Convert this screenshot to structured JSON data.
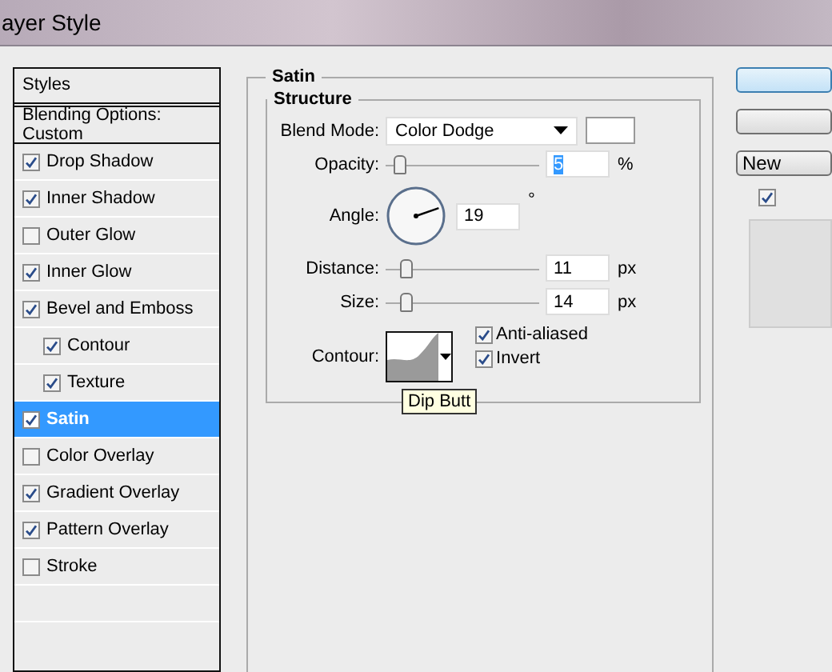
{
  "window": {
    "title": "ayer Style"
  },
  "sidebar": {
    "header": "Styles",
    "items": [
      {
        "kind": "option",
        "label": "Blending Options: Custom",
        "selected": false
      },
      {
        "kind": "effect",
        "label": "Drop Shadow",
        "checked": true,
        "selected": false
      },
      {
        "kind": "effect",
        "label": "Inner Shadow",
        "checked": true,
        "selected": false
      },
      {
        "kind": "effect",
        "label": "Outer Glow",
        "checked": false,
        "selected": false
      },
      {
        "kind": "effect",
        "label": "Inner Glow",
        "checked": true,
        "selected": false
      },
      {
        "kind": "effect",
        "label": "Bevel and Emboss",
        "checked": true,
        "selected": false,
        "children": [
          {
            "kind": "effect",
            "label": "Contour",
            "checked": true,
            "selected": false
          },
          {
            "kind": "effect",
            "label": "Texture",
            "checked": true,
            "selected": false
          }
        ]
      },
      {
        "kind": "effect",
        "label": "Satin",
        "checked": true,
        "selected": true
      },
      {
        "kind": "effect",
        "label": "Color Overlay",
        "checked": false,
        "selected": false
      },
      {
        "kind": "effect",
        "label": "Gradient Overlay",
        "checked": true,
        "selected": false
      },
      {
        "kind": "effect",
        "label": "Pattern Overlay",
        "checked": true,
        "selected": false
      },
      {
        "kind": "effect",
        "label": "Stroke",
        "checked": false,
        "selected": false
      }
    ]
  },
  "panel": {
    "title": "Satin",
    "group": "Structure",
    "blend_mode": {
      "label": "Blend Mode:",
      "value": "Color Dodge",
      "color": "#ffffff"
    },
    "opacity": {
      "label": "Opacity:",
      "level": 0.05,
      "value": "5",
      "value_selected": true,
      "unit": "%"
    },
    "angle": {
      "label": "Angle:",
      "value": "19",
      "unit": "°"
    },
    "distance": {
      "label": "Distance:",
      "level": 0.1,
      "value": "11",
      "unit": "px"
    },
    "size": {
      "label": "Size:",
      "level": 0.1,
      "value": "14",
      "unit": "px"
    },
    "contour": {
      "label": "Contour:",
      "tooltip": "Dip Butt"
    },
    "options": [
      {
        "label": "Anti-aliased",
        "checked": true
      },
      {
        "label": "Invert",
        "checked": true
      }
    ]
  },
  "right": {
    "buttons": [
      {
        "kind": "default"
      },
      {
        "kind": "plain"
      },
      {
        "kind": "plain",
        "label": "New"
      }
    ],
    "preview_checked": true
  }
}
